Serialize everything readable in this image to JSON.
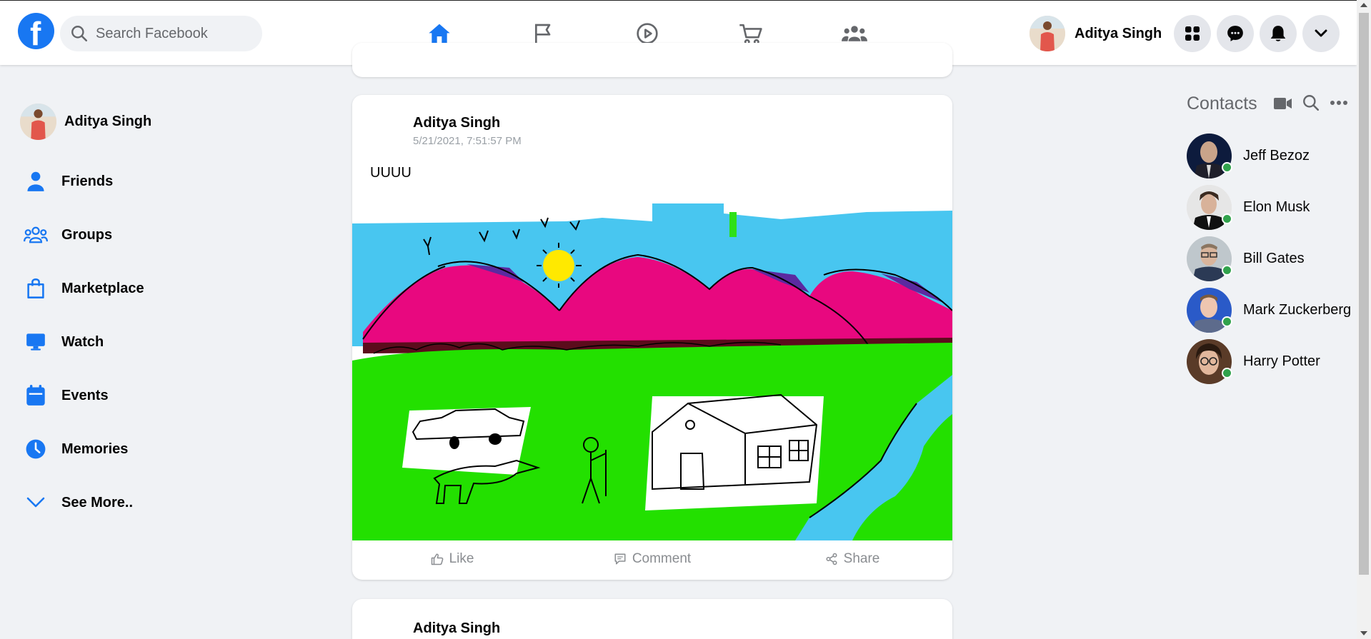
{
  "header": {
    "logo_letter": "f",
    "search_placeholder": "Search Facebook",
    "nav": [
      {
        "name": "home-icon",
        "active": true
      },
      {
        "name": "pages-flag-icon",
        "active": false
      },
      {
        "name": "watch-play-icon",
        "active": false
      },
      {
        "name": "marketplace-cart-icon",
        "active": false
      },
      {
        "name": "groups-icon",
        "active": false
      }
    ],
    "user_name": "Aditya Singh",
    "buttons": [
      "menu-grid-icon",
      "messenger-icon",
      "notifications-bell-icon",
      "account-chevron-icon"
    ]
  },
  "sidebar": {
    "profile_name": "Aditya Singh",
    "items": [
      {
        "label": "Friends",
        "icon": "friends-icon"
      },
      {
        "label": "Groups",
        "icon": "groups-icon"
      },
      {
        "label": "Marketplace",
        "icon": "marketplace-bag-icon"
      },
      {
        "label": "Watch",
        "icon": "watch-monitor-icon"
      },
      {
        "label": "Events",
        "icon": "events-calendar-icon"
      },
      {
        "label": "Memories",
        "icon": "memories-clock-icon"
      },
      {
        "label": "See More..",
        "icon": "chevron-down-icon"
      }
    ]
  },
  "feed": {
    "posts": [
      {
        "author": "Aditya Singh",
        "timestamp": "5/21/2021, 7:51:57 PM",
        "text": "UUUU",
        "actions": {
          "like": "Like",
          "comment": "Comment",
          "share": "Share"
        }
      },
      {
        "author": "Aditya Singh"
      }
    ]
  },
  "contacts": {
    "title": "Contacts",
    "people": [
      {
        "name": "Jeff Bezoz",
        "online": true
      },
      {
        "name": "Elon Musk",
        "online": true
      },
      {
        "name": "Bill Gates",
        "online": true
      },
      {
        "name": "Mark Zuckerberg",
        "online": true
      },
      {
        "name": "Harry Potter",
        "online": true
      }
    ]
  },
  "colors": {
    "brand": "#1877f2",
    "online": "#31a24c",
    "background": "#f0f2f5"
  }
}
